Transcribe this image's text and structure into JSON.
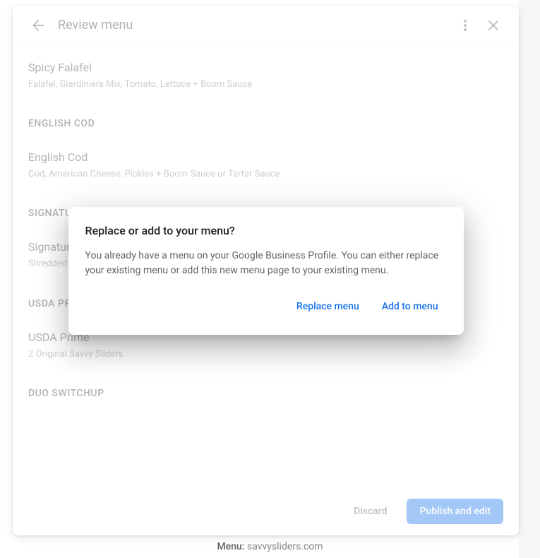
{
  "header": {
    "title": "Review menu"
  },
  "menu": {
    "items": [
      {
        "name": "Spicy Falafel",
        "desc": "Falafel, Giardiniera Mix, Tomato, Lettuce + Boom Sauce"
      }
    ],
    "sections": [
      {
        "title": "ENGLISH COD",
        "items": [
          {
            "name": "English Cod",
            "desc": "Cod, American Cheese, Pickles + Boom Sauce or Tartar Sauce"
          }
        ]
      },
      {
        "title": "SIGNATURE",
        "items": [
          {
            "name": "Signature",
            "desc": "Shredded"
          }
        ]
      },
      {
        "title": "USDA PRIME",
        "items": [
          {
            "name": "USDA Prime",
            "desc": "2 Original Savvy Sliders"
          }
        ]
      },
      {
        "title": "DUO SWITCHUP",
        "items": []
      }
    ]
  },
  "footer": {
    "discard": "Discard",
    "publish": "Publish and edit"
  },
  "dialog": {
    "title": "Replace or add to your menu?",
    "body": "You already have a menu on your Google Business Profile. You can either replace your existing menu or add this new menu page to your existing menu.",
    "replace": "Replace menu",
    "add": "Add to menu"
  },
  "bottom": {
    "label": "Menu:",
    "value": "savvysliders.com"
  }
}
